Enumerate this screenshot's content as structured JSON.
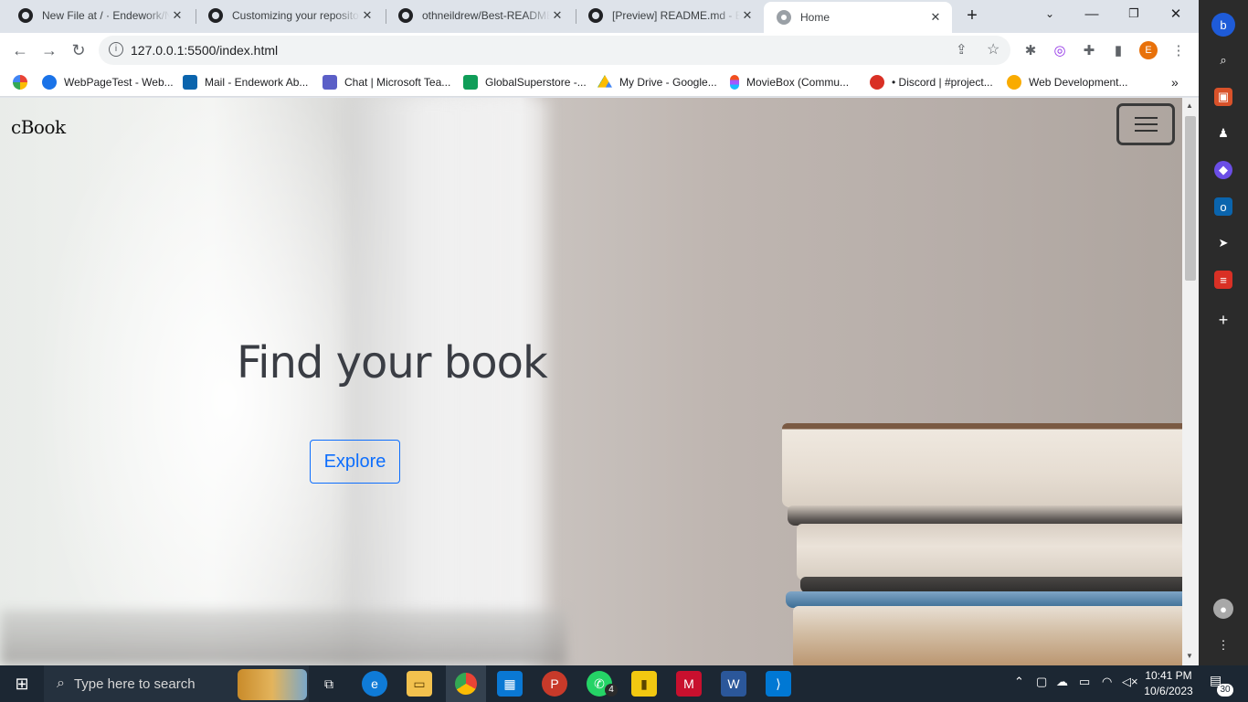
{
  "tabs": [
    {
      "title": "New File at / · Endework/Ne",
      "icon": "github-icon"
    },
    {
      "title": "Customizing your repository",
      "icon": "github-icon"
    },
    {
      "title": "othneildrew/Best-README-Template",
      "icon": "github-icon"
    },
    {
      "title": "[Preview] README.md - Best",
      "icon": "github-icon"
    },
    {
      "title": "Home",
      "icon": "globe-icon",
      "active": true
    }
  ],
  "toolbar": {
    "url": "127.0.0.1:5500/index.html",
    "profile_initial": "E"
  },
  "bookmarks": [
    {
      "label": "WebPageTest - Web...",
      "color": "#1a73e8"
    },
    {
      "label": "Mail - Endework Ab...",
      "color": "#0a64ad"
    },
    {
      "label": "Chat | Microsoft Tea...",
      "color": "#5b5fc7"
    },
    {
      "label": "GlobalSuperstore -...",
      "color": "#0f9d58"
    },
    {
      "label": "My Drive - Google...",
      "color": "#fbbc04"
    },
    {
      "label": "MovieBox (Commu...",
      "color": "#f24e1e"
    },
    {
      "label": "• Discord | #project...",
      "color": "#d93025"
    },
    {
      "label": "Web Development...",
      "color": "#f9ab00"
    }
  ],
  "page": {
    "brand": "cBook",
    "headline": "Find your book",
    "cta": "Explore"
  },
  "taskbar": {
    "search_placeholder": "Type here to search",
    "time": "10:41 PM",
    "date": "10/6/2023",
    "whatsapp_badge": "4",
    "notification_count": "30"
  },
  "colors": {
    "cta_accent": "#0d6efd",
    "tabstrip": "#dee3ea",
    "taskbar": "#1c2733"
  }
}
